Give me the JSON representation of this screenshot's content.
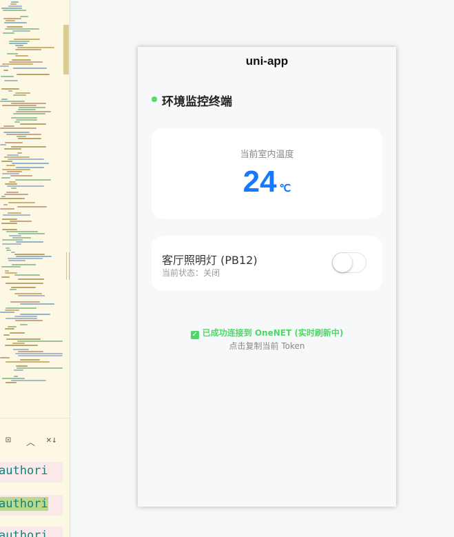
{
  "editor": {
    "toolbar": {
      "terminal_icon": "⊡",
      "up_icon": "︿",
      "close_icon": "✕↓"
    },
    "code_lines": [
      "authori",
      "authori",
      "authori"
    ]
  },
  "phone": {
    "navbar_title": "uni-app",
    "header_title": "环境监控终端",
    "temperature": {
      "label": "当前室内温度",
      "value": "24",
      "unit": "℃"
    },
    "light": {
      "name": "客厅照明灯 (PB12)",
      "status": "当前状态：关闭",
      "on": false
    },
    "connection": {
      "text": "已成功连接到 OneNET (实时刷新中)",
      "copy_hint": "点击复制当前 Token"
    },
    "colors": {
      "accent": "#1677ff",
      "online": "#4cd964"
    }
  }
}
